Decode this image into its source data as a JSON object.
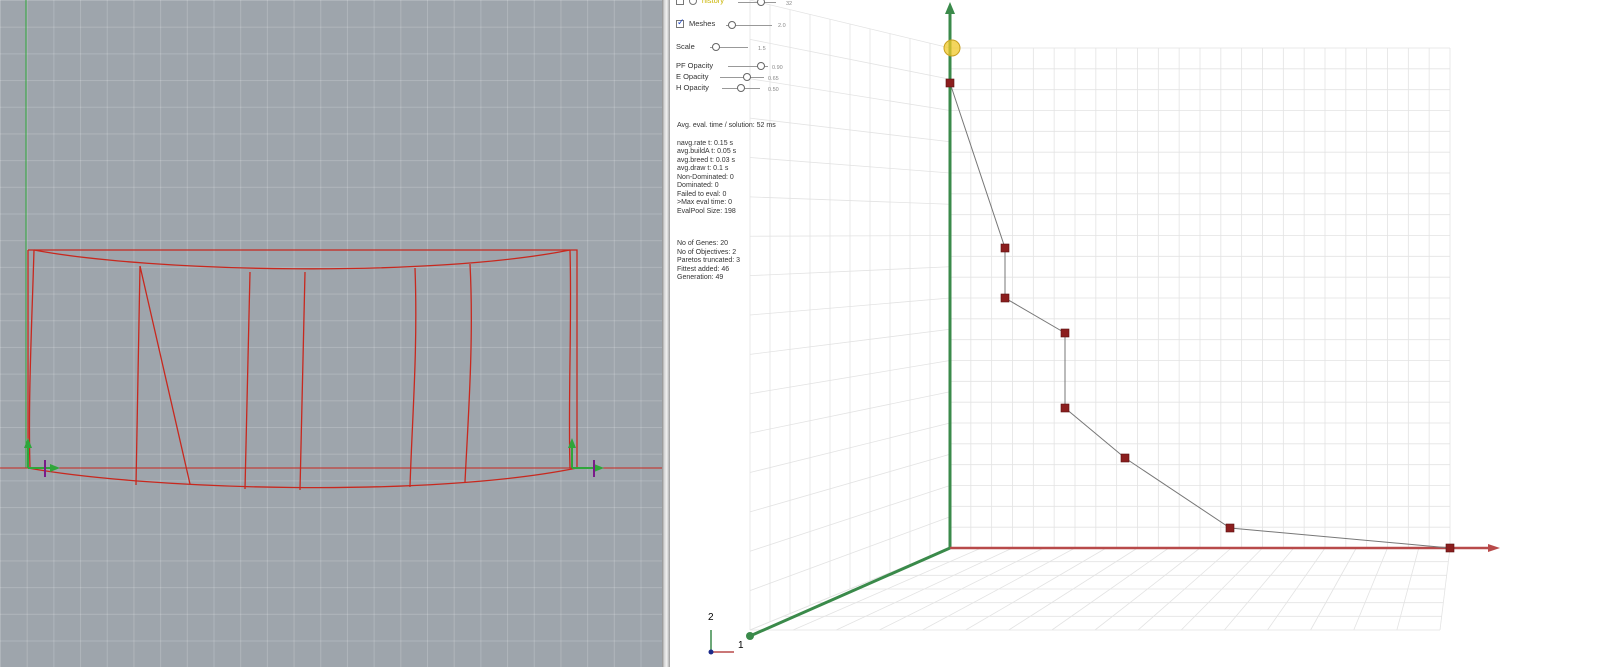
{
  "left_view": {
    "name": "Geometry viewport"
  },
  "controls": {
    "history": {
      "label": "history",
      "checked": false,
      "value": "32",
      "level": 0.62
    },
    "meshes": {
      "label": "Meshes",
      "checked": true,
      "value": "2.0",
      "level": 0.05
    },
    "scale": {
      "label": "Scale",
      "value": "1.5",
      "level": 0.05
    },
    "pf_opacity": {
      "label": "PF Opacity",
      "value": "0.90",
      "level": 0.9
    },
    "e_opacity": {
      "label": "E Opacity",
      "value": "0.65",
      "level": 0.65
    },
    "h_opacity": {
      "label": "H Opacity",
      "value": "0.50",
      "level": 0.5
    }
  },
  "stats": {
    "avg_eval": "Avg. eval. time / solution: 52 ms",
    "lines1": [
      "navg.rate t: 0.15 s",
      "avg.buildA t: 0.05 s",
      "avg.breed t: 0.03 s",
      "avg.draw t: 0.1 s",
      "Non-Dominated: 0",
      "Dominated: 0",
      "Failed to eval: 0",
      ">Max eval time: 0",
      "EvalPool Size: 198"
    ],
    "lines2": [
      "No of Genes: 20",
      "No of Objectives: 2",
      "Paretos truncated: 3",
      "Fittest added: 46",
      "Generation: 49"
    ]
  },
  "axis_labels": {
    "y_axis": "2",
    "x_axis": "1"
  },
  "colors": {
    "viewport_bg": "#9ea5ac",
    "geometry": "#c8281e",
    "axis_green": "#3a8a4a",
    "axis_red": "#b84a4a",
    "point": "#8b1e1e"
  },
  "chart_data": {
    "type": "scatter",
    "xlabel": "1",
    "ylabel": "2",
    "grid": true,
    "x": [
      0.0,
      0.11,
      0.11,
      0.23,
      0.23,
      0.35,
      0.56,
      1.0
    ],
    "y": [
      0.93,
      0.6,
      0.5,
      0.43,
      0.28,
      0.18,
      0.04,
      0.0
    ],
    "xlim": [
      0,
      1
    ],
    "ylim": [
      0,
      1
    ]
  }
}
